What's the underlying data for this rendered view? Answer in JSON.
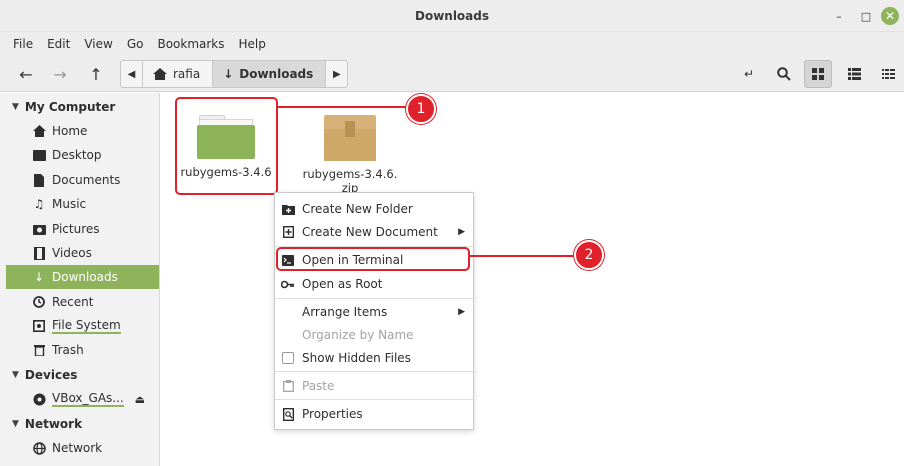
{
  "window": {
    "title": "Downloads",
    "minimize_glyph": "–",
    "maximize_glyph": "□",
    "close_glyph": "✕"
  },
  "menubar": [
    "File",
    "Edit",
    "View",
    "Go",
    "Bookmarks",
    "Help"
  ],
  "pathbar": {
    "crumbs": [
      "rafia",
      "Downloads"
    ],
    "active": "Downloads"
  },
  "sidebar": {
    "sections": [
      {
        "label": "My Computer",
        "items": [
          {
            "label": "Home",
            "icon": "home-icon"
          },
          {
            "label": "Desktop",
            "icon": "desktop-icon"
          },
          {
            "label": "Documents",
            "icon": "documents-icon"
          },
          {
            "label": "Music",
            "icon": "music-icon"
          },
          {
            "label": "Pictures",
            "icon": "pictures-icon"
          },
          {
            "label": "Videos",
            "icon": "videos-icon"
          },
          {
            "label": "Downloads",
            "icon": "downloads-icon",
            "active": true
          },
          {
            "label": "Recent",
            "icon": "recent-icon"
          },
          {
            "label": "File System",
            "icon": "filesystem-icon"
          },
          {
            "label": "Trash",
            "icon": "trash-icon"
          }
        ]
      },
      {
        "label": "Devices",
        "items": [
          {
            "label": "VBox_GAs...",
            "icon": "disc-icon"
          }
        ]
      },
      {
        "label": "Network",
        "items": [
          {
            "label": "Network",
            "icon": "network-icon"
          }
        ]
      }
    ]
  },
  "files": [
    {
      "name": "rubygems-3.4.6",
      "type": "folder"
    },
    {
      "name": "rubygems-3.4.6.\nzip",
      "type": "archive"
    }
  ],
  "context_menu": {
    "items": [
      {
        "label": "Create New Folder",
        "icon": "new-folder-icon"
      },
      {
        "label": "Create New Document",
        "icon": "new-document-icon",
        "submenu": true
      },
      {
        "label": "Open in Terminal",
        "icon": "terminal-icon"
      },
      {
        "label": "Open as Root",
        "icon": "key-icon"
      },
      {
        "label": "Arrange Items",
        "submenu": true
      },
      {
        "label": "Organize by Name",
        "disabled": true
      },
      {
        "label": "Show Hidden Files",
        "checkbox": true,
        "checked": false
      },
      {
        "label": "Paste",
        "icon": "paste-icon",
        "disabled": true
      },
      {
        "label": "Properties",
        "icon": "properties-icon"
      }
    ]
  },
  "annotations": {
    "badge_1": "1",
    "badge_2": "2",
    "color": "#e0202a"
  },
  "colors": {
    "accent": "#8fb35a",
    "folder": "#8cb357",
    "archive": "#cfa867"
  }
}
